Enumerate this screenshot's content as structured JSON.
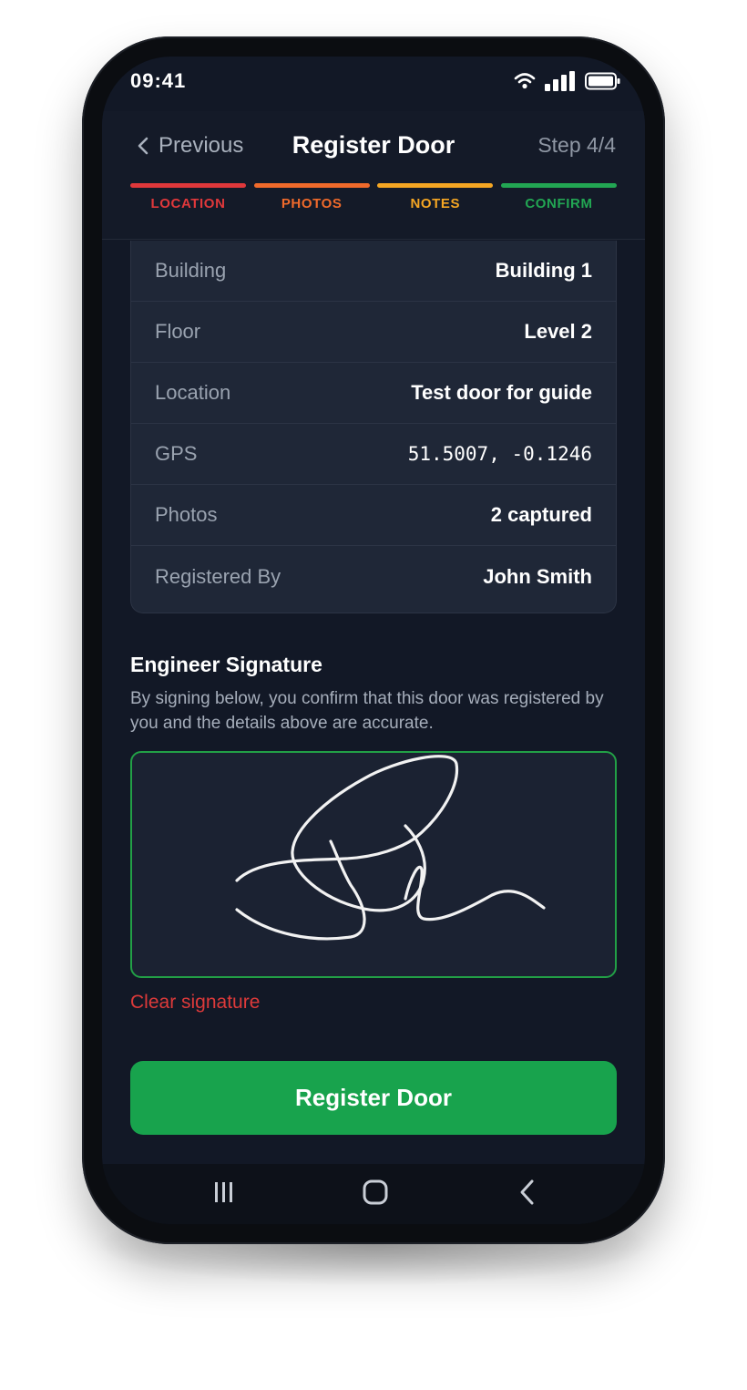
{
  "status": {
    "time": "09:41",
    "icons": [
      "wifi-icon",
      "signal-icon",
      "battery-icon"
    ]
  },
  "header": {
    "back_label": "Previous",
    "title": "Register Door",
    "step": "Step 4/4",
    "steps": [
      {
        "label": "LOCATION",
        "color": "#e0383b"
      },
      {
        "label": "PHOTOS",
        "color": "#f06a2b"
      },
      {
        "label": "NOTES",
        "color": "#f5a623"
      },
      {
        "label": "CONFIRM",
        "color": "#22a653"
      }
    ]
  },
  "summary": {
    "rows": [
      {
        "key": "Building",
        "value": "Building 1"
      },
      {
        "key": "Floor",
        "value": "Level 2"
      },
      {
        "key": "Location",
        "value": "Test door for guide"
      },
      {
        "key": "GPS",
        "value": "51.5007, -0.1246"
      },
      {
        "key": "Photos",
        "value": "2 captured"
      },
      {
        "key": "Registered By",
        "value": "John Smith"
      }
    ]
  },
  "signature": {
    "title": "Engineer Signature",
    "description": "By signing below, you confirm that this door was registered by you and the details above are accurate.",
    "clear_label": "Clear signature",
    "border_color": "#22a046"
  },
  "actions": {
    "register_label": "Register Door",
    "register_color": "#18a34d"
  },
  "navbar": {
    "icons": [
      "recent-apps-icon",
      "home-icon",
      "back-icon"
    ]
  }
}
